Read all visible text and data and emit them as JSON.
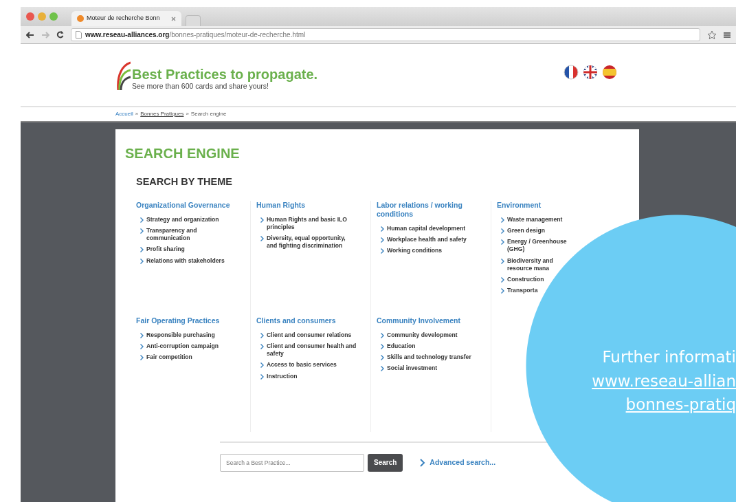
{
  "browser": {
    "tab_title": "Moteur de recherche Bonn",
    "url_domain": "www.reseau-alliances.org",
    "url_path": "/bonnes-pratiques/moteur-de-recherche.html"
  },
  "header": {
    "title": "Best Practices to propagate.",
    "tagline": "See more than 600 cards and share yours!"
  },
  "breadcrumb": [
    {
      "text": "Accueil",
      "kind": "link"
    },
    {
      "text": "»",
      "kind": "sep"
    },
    {
      "text": "Bonnes Pratiques",
      "kind": "underlined"
    },
    {
      "text": "»",
      "kind": "sep"
    },
    {
      "text": "Search engine",
      "kind": "current"
    }
  ],
  "page_title": "SEARCH ENGINE",
  "section_title": "SEARCH BY THEME",
  "themes": [
    {
      "title": "Organizational Governance",
      "items": [
        "Strategy and organization",
        "Transparency and communication",
        "Profit sharing",
        "Relations with stakeholders"
      ]
    },
    {
      "title": "Human Rights",
      "items": [
        "Human Rights and basic ILO principles",
        "Diversity, equal opportunity, and fighting discrimination"
      ]
    },
    {
      "title": "Labor relations / working conditions",
      "items": [
        "Human capital development",
        "Workplace health and safety",
        "Working conditions"
      ]
    },
    {
      "title": "Environment",
      "items": [
        "Waste management",
        "Green design",
        "Energy / Greenhouse\n(GHG)",
        "Biodiversity and\nresource mana",
        "Construction",
        "Transporta"
      ]
    },
    {
      "title": "Fair Operating Practices",
      "items": [
        "Responsible purchasing",
        "Anti-corruption campaign",
        "Fair competition"
      ]
    },
    {
      "title": "Clients and consumers",
      "items": [
        "Client and consumer relations",
        "Client and consumer health and safety",
        "Access to basic services",
        "Instruction"
      ]
    },
    {
      "title": "Community Involvement",
      "items": [
        "Community development",
        "Education",
        "Skills and technology transfer",
        "Social investment"
      ]
    }
  ],
  "search": {
    "placeholder": "Search a Best Practice...",
    "button": "Search",
    "advanced_link": "Advanced search..."
  },
  "callout": {
    "lines": [
      {
        "text": "Further informati",
        "underline": false
      },
      {
        "text": "www.reseau-allian",
        "underline": true
      },
      {
        "text": "bonnes-pratiq",
        "underline": true
      }
    ]
  }
}
